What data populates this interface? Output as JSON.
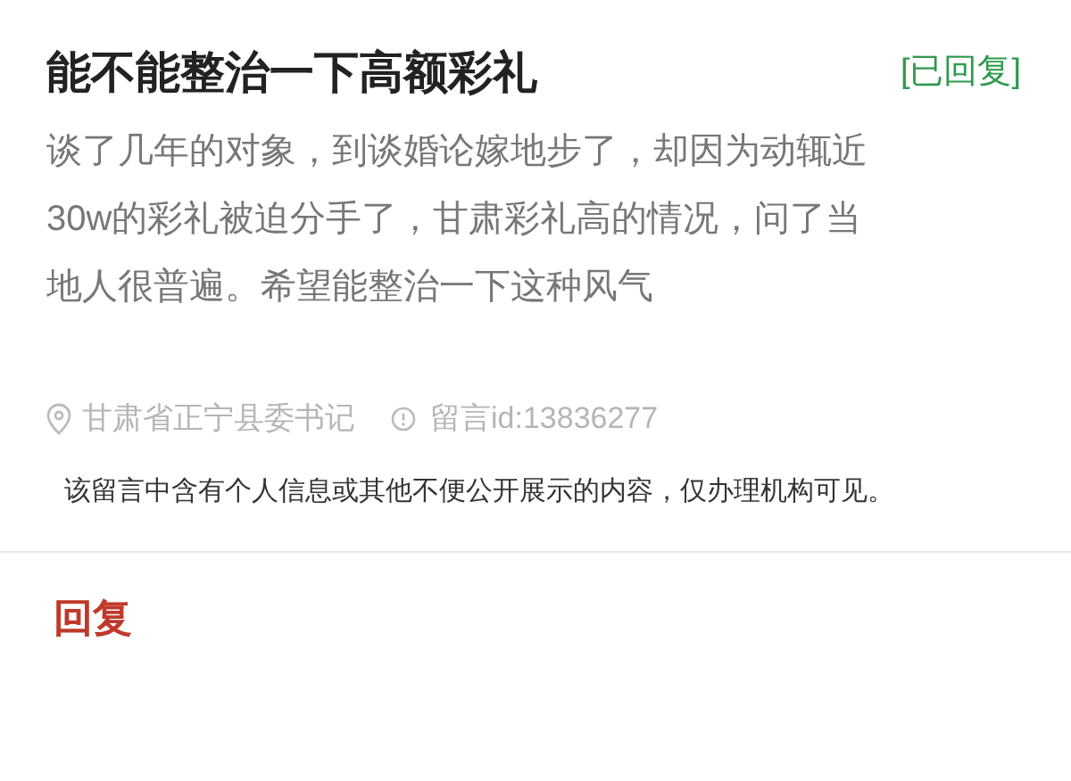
{
  "post": {
    "title": "能不能整治一下高额彩礼",
    "status": "[已回复]",
    "body": "谈了几年的对象，到谈婚论嫁地步了，却因为动辄近30w的彩礼被迫分手了，甘肃彩礼高的情况，问了当地人很普遍。希望能整治一下这种风气",
    "recipient": "甘肃省正宁县委书记",
    "message_id": "留言id:13836277",
    "notice": "该留言中含有个人信息或其他不便公开展示的内容，仅办理机构可见。"
  },
  "reply": {
    "heading": "回复"
  }
}
